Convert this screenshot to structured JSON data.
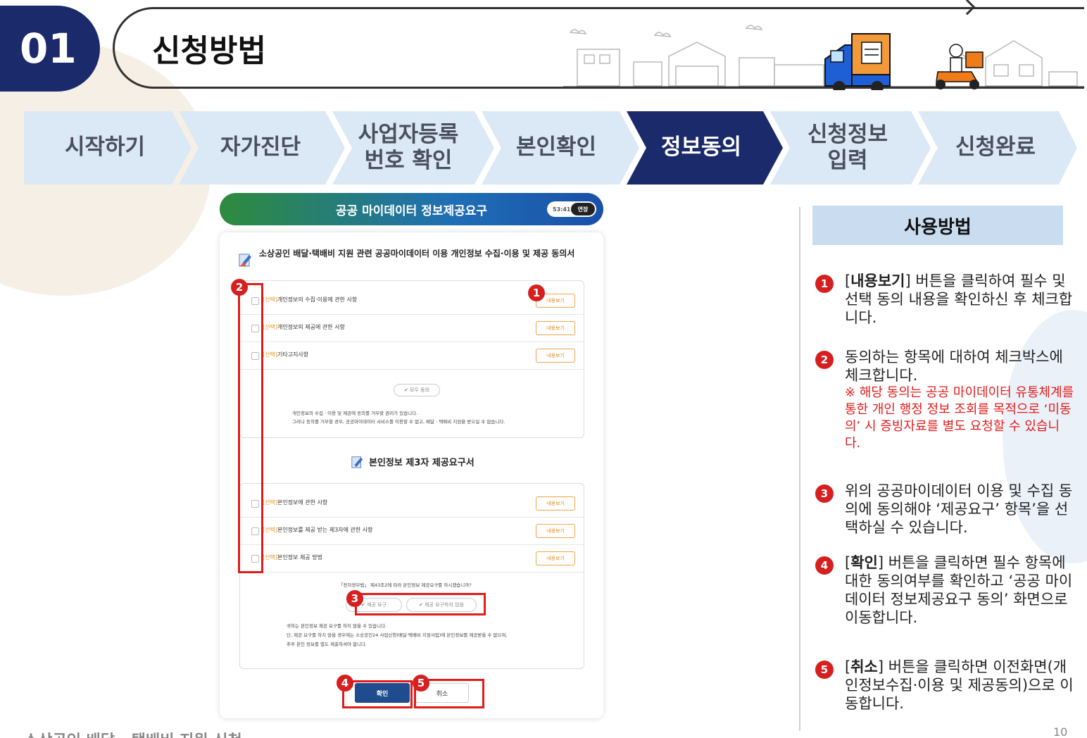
{
  "header": {
    "number": "01",
    "title": "신청방법"
  },
  "steps": [
    {
      "label": "시작하기",
      "active": false
    },
    {
      "label": "자가진단",
      "active": false
    },
    {
      "label": "사업자등록 번호 확인",
      "line1": "사업자등록",
      "line2": "번호 확인",
      "active": false
    },
    {
      "label": "본인확인",
      "active": false
    },
    {
      "label": "정보동의",
      "active": true
    },
    {
      "label": "신청정보 입력",
      "line1": "신청정보",
      "line2": "입력",
      "active": false
    },
    {
      "label": "신청완료",
      "active": false
    }
  ],
  "mock": {
    "header_title": "공공 마이데이터 정보제공요구",
    "timer": "53:41",
    "extend": "연장",
    "panel_title": "소상공인 배달·택배비 지원 관련 공공마이데이터 이용 개인정보 수집·이용 및 제공 동의서",
    "section1_rows": [
      {
        "tag": "[선택]",
        "label": "개인정보의 수집·이용에 관한 사항",
        "button": "내용보기"
      },
      {
        "tag": "[선택]",
        "label": "개인정보의 제공에 관한 사항",
        "button": "내용보기"
      },
      {
        "tag": "[선택]",
        "label": "기타고지사항",
        "button": "내용보기"
      }
    ],
    "agree_all": "모두 동의",
    "notice1_line1": "개인정보의 수집 · 이용 및 제공에 동의를 거부할 권리가 있습니다.",
    "notice1_line2": "그러나 동의를 거부할 경우, 공공마이데이터 서비스를 이용할 수 없고, 배달 · 택배비 지원을 받으실 수 없습니다.",
    "section2_title": "본인정보 제3자 제공요구서",
    "section2_rows": [
      {
        "tag": "[선택]",
        "label": "본인정보에 관한 사항",
        "button": "내용보기"
      },
      {
        "tag": "[선택]",
        "label": "본인정보를 제공 받는 제3자에 관한 사항",
        "button": "내용보기"
      },
      {
        "tag": "[선택]",
        "label": "본인정보 제공 방법",
        "button": "내용보기"
      }
    ],
    "question": "「전자정부법」 제43조2에 따라 본인정보 제공요구를 하시겠습니까?",
    "option_yes": "제공 요구",
    "option_no": "제공 요구하지 않음",
    "notice2_line1": "귀하는 본인정보 제공 요구를 하지 않을 수 있습니다.",
    "notice2_line2": "단, 제공 요구를 하지 않을 경우에는 소상공인24 사업신청(배달·택배비 지원사업)에 본인정보를 제공받을 수 없으며,",
    "notice2_line3": "추후 본인 정보를 별도 제출하셔야 합니다.",
    "ok_button": "확인",
    "cancel_button": "취소",
    "markers": [
      "1",
      "2",
      "3",
      "4",
      "5"
    ]
  },
  "usage": {
    "title": "사용방법",
    "items": [
      {
        "num": "1",
        "bold": "내용보기",
        "pre": "[",
        "post": "] 버튼을 클릭하여 필수 및 선택 동의 내용을 확인하신 후 체크합니다."
      },
      {
        "num": "2",
        "text": "동의하는 항목에 대하여 체크박스에 체크합니다.",
        "note": "※ 해당 동의는 공공 마이데이터 유통체계를 통한 개인 행정 정보 조회를 목적으로 ‘미동의’ 시 증빙자료를 별도 요청할 수 있습니다."
      },
      {
        "num": "3",
        "text": "위의 공공마이데이터 이용 및 수집 동의에 동의해야 ‘제공요구’ 항목’을 선택하실 수 있습니다."
      },
      {
        "num": "4",
        "bold": "확인",
        "pre": "[",
        "post": "] 버튼을 클릭하면 필수 항목에 대한 동의여부를 확인하고 ‘공공 마이데이터 정보제공요구 동의’ 화면으로 이동합니다."
      },
      {
        "num": "5",
        "bold": "취소",
        "pre": "[",
        "post": "] 버튼을 클릭하면 이전화면(개인정보수집·이용 및 제공동의)으로 이동합니다."
      }
    ]
  },
  "footer": "소상공인 배달 · 택배비 지원 신청",
  "page_number": "10",
  "colors": {
    "navy": "#1b2a6b",
    "step_bg": "#dbe8f5",
    "accent_red": "#e21b1b",
    "usage_header": "#c9dcf0"
  }
}
